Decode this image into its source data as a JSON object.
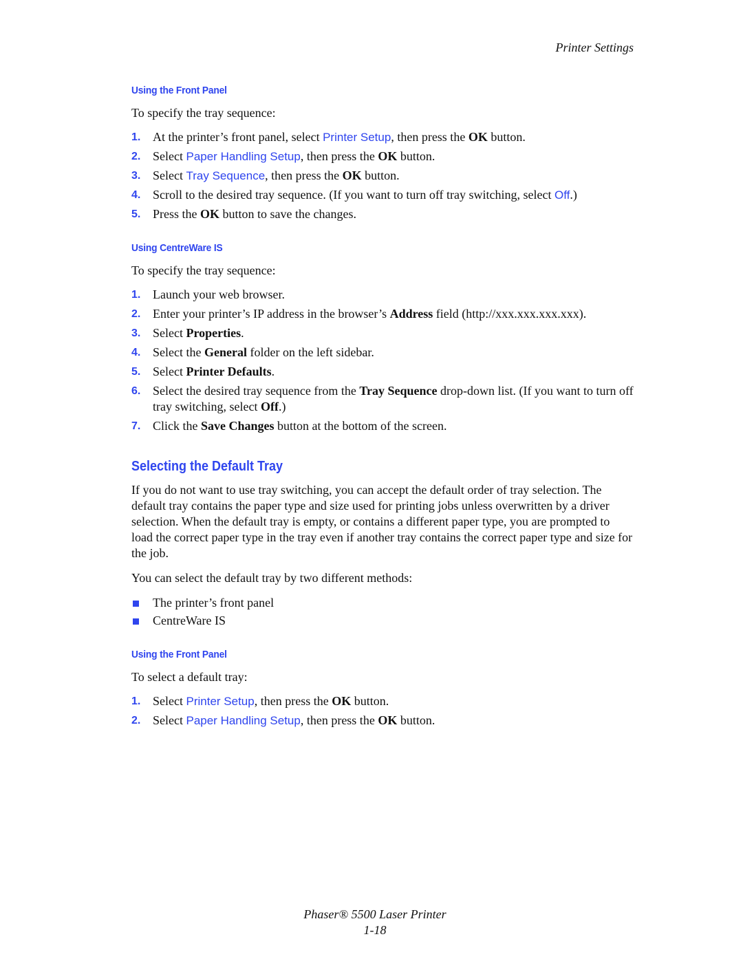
{
  "header": {
    "running_title": "Printer Settings"
  },
  "colors": {
    "accent": "#2f45ee",
    "text": "#111111"
  },
  "section1": {
    "heading": "Using the Front Panel",
    "intro": "To specify the tray sequence:",
    "steps": [
      {
        "num": "1.",
        "pre": "At the printer’s front panel, select ",
        "ui": "Printer Setup",
        "mid": ", then press the ",
        "bold": "OK",
        "post": " button."
      },
      {
        "num": "2.",
        "pre": "Select ",
        "ui": "Paper Handling Setup",
        "mid": ", then press the ",
        "bold": "OK",
        "post": " button."
      },
      {
        "num": "3.",
        "pre": "Select ",
        "ui": "Tray Sequence",
        "mid": ", then press the ",
        "bold": "OK",
        "post": " button."
      },
      {
        "num": "4.",
        "pre": "Scroll to the desired tray sequence. (If you want to turn off tray switching, select ",
        "ui": "Off",
        "post": ".)"
      },
      {
        "num": "5.",
        "pre": "Press the ",
        "bold": "OK",
        "post": " button to save the changes."
      }
    ]
  },
  "section2": {
    "heading": "Using CentreWare IS",
    "intro": "To specify the tray sequence:",
    "steps": [
      {
        "num": "1.",
        "pre": "Launch your web browser."
      },
      {
        "num": "2.",
        "pre": "Enter your printer’s IP address in the browser’s ",
        "bold": "Address",
        "post": " field (http://xxx.xxx.xxx.xxx)."
      },
      {
        "num": "3.",
        "pre": "Select ",
        "bold": "Properties",
        "post": "."
      },
      {
        "num": "4.",
        "pre": "Select the ",
        "bold": "General",
        "post": " folder on the left sidebar."
      },
      {
        "num": "5.",
        "pre": "Select ",
        "bold": "Printer Defaults",
        "post": "."
      },
      {
        "num": "6.",
        "pre": "Select the desired tray sequence from the ",
        "bold": "Tray Sequence",
        "mid": " drop-down list. (If you want to turn off tray switching, select ",
        "bold2": "Off",
        "post": ".)"
      },
      {
        "num": "7.",
        "pre": "Click the ",
        "bold": "Save Changes",
        "post": " button at the bottom of the screen."
      }
    ]
  },
  "section3": {
    "heading": "Selecting the Default Tray",
    "paragraph": "If you do not want to use tray switching, you can accept the default order of tray selection. The default tray contains the paper type and size used for printing jobs unless overwritten by a driver selection. When the default tray is empty, or contains a different paper type, you are prompted to load the correct paper type in the tray even if another tray contains the correct paper type and size for the job.",
    "methods_intro": "You can select the default tray by two different methods:",
    "methods": [
      "The printer’s front panel",
      "CentreWare IS"
    ]
  },
  "section4": {
    "heading": "Using the Front Panel",
    "intro": "To select a default tray:",
    "steps": [
      {
        "num": "1.",
        "pre": "Select ",
        "ui": "Printer Setup",
        "mid": ", then press the ",
        "bold": "OK",
        "post": " button."
      },
      {
        "num": "2.",
        "pre": "Select ",
        "ui": "Paper Handling Setup",
        "mid": ", then press the ",
        "bold": "OK",
        "post": " button."
      }
    ]
  },
  "footer": {
    "product": "Phaser® 5500 Laser Printer",
    "page_number": "1-18"
  }
}
